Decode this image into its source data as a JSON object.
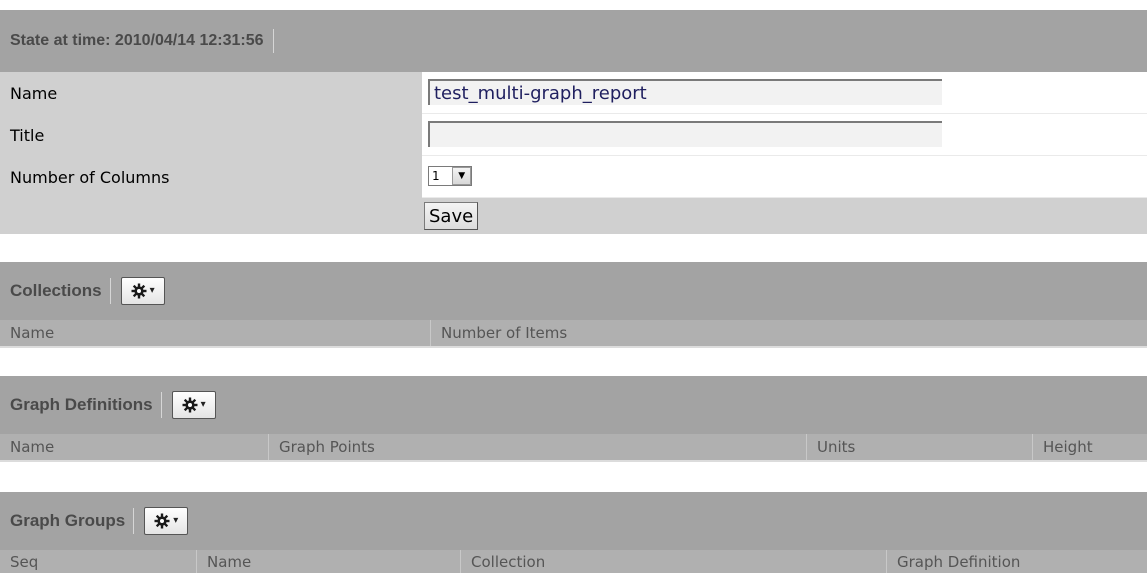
{
  "state": {
    "title": "State at time: 2010/04/14 12:31:56"
  },
  "form": {
    "name_label": "Name",
    "name_value": "test_multi-graph_report",
    "title_label": "Title",
    "title_value": "",
    "columns_label": "Number of Columns",
    "columns_value": "1",
    "save_label": "Save"
  },
  "collections": {
    "title": "Collections",
    "columns": [
      "Name",
      "Number of Items"
    ]
  },
  "graph_definitions": {
    "title": "Graph Definitions",
    "columns": [
      "Name",
      "Graph Points",
      "Units",
      "Height"
    ]
  },
  "graph_groups": {
    "title": "Graph Groups",
    "columns": [
      "Seq",
      "Name",
      "Collection",
      "Graph Definition"
    ]
  },
  "icons": {
    "actions_menu": "gear-icon",
    "dropdown": "caret-down-icon"
  }
}
